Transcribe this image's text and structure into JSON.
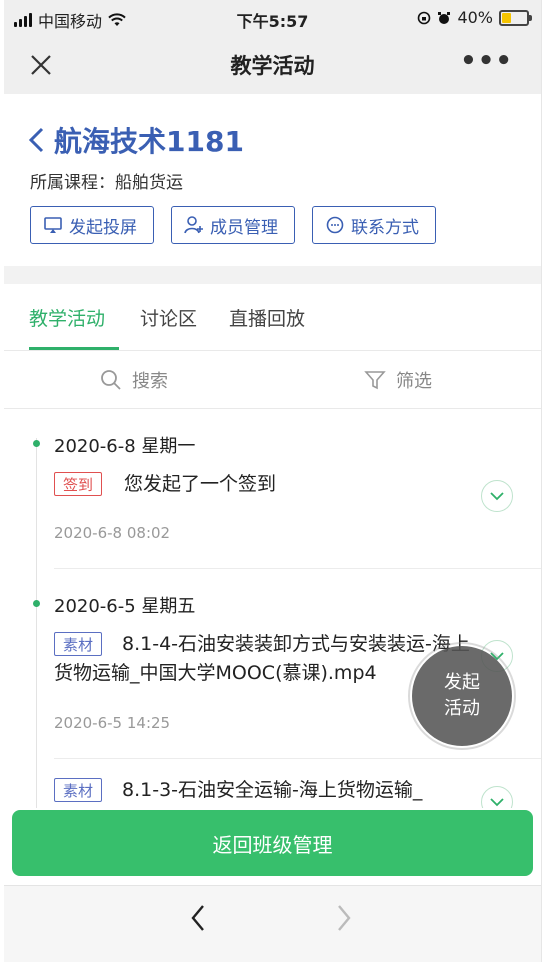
{
  "status_bar": {
    "carrier": "中国移动",
    "time": "下午5:57",
    "battery_percent": "40%",
    "battery_level": 0.4,
    "battery_color": "#f5c400"
  },
  "nav": {
    "title": "教学活动",
    "close_icon": "close-icon",
    "more_label": "•••"
  },
  "header": {
    "class_name": "航海技术1181",
    "course_line": "所属课程：船舶货运",
    "buttons": [
      {
        "label": "发起投屏",
        "icon": "screencast-icon"
      },
      {
        "label": "成员管理",
        "icon": "member-add-icon"
      },
      {
        "label": "联系方式",
        "icon": "chat-icon"
      }
    ],
    "accent_color": "#3a5fb3"
  },
  "tabs": [
    {
      "label": "教学活动",
      "active": true
    },
    {
      "label": "讨论区",
      "active": false
    },
    {
      "label": "直播回放",
      "active": false
    }
  ],
  "search": {
    "search_label": "搜索",
    "filter_label": "筛选"
  },
  "activities": [
    {
      "date": "2020-6-8 星期一",
      "tag": "签到",
      "text": "您发起了一个签到",
      "time": "2020-6-8 08:02"
    },
    {
      "date": "2020-6-5 星期五",
      "tag": "素材",
      "text": "8.1-4-石油安装装卸方式与安装装运-海上货物运输_中国大学MOOC(慕课).mp4",
      "time": "2020-6-5 14:25"
    },
    {
      "date": "",
      "tag": "素材",
      "text": "8.1-3-石油安全运输-海上货物运输_",
      "time": ""
    }
  ],
  "fab": {
    "line1": "发起",
    "line2": "活动"
  },
  "return_button": "返回班级管理",
  "colors": {
    "green": "#2fb06a",
    "return_green": "#37bf6c",
    "sign_red": "#e05050",
    "material_blue": "#5b6fc2"
  }
}
